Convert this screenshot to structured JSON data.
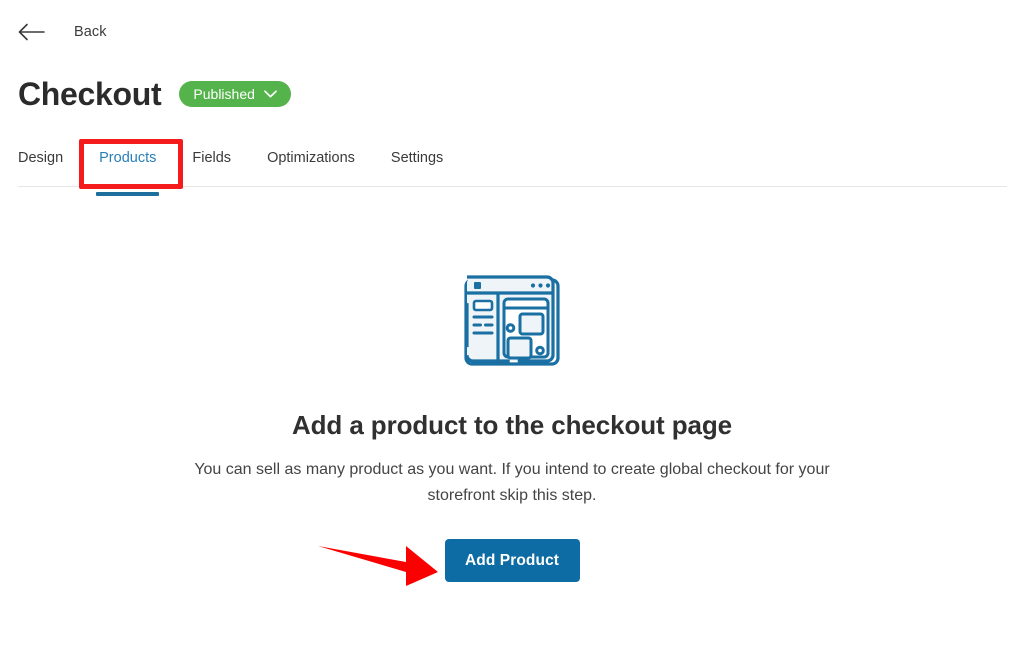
{
  "colors": {
    "accent_blue": "#0e6ca4",
    "tab_active_blue": "#2a7fb8",
    "tab_underline_blue": "#1d6f9e",
    "badge_green": "#54b44b",
    "annotation_red": "#f31b1b",
    "illustration_blue": "#1a6fa3",
    "text_dark": "#2b2b2b",
    "text_body": "#444444",
    "divider": "#e6e6e6"
  },
  "header": {
    "back_label": "Back",
    "back_icon": "arrow-left-icon",
    "title": "Checkout",
    "status": {
      "label": "Published",
      "icon": "chevron-down-icon"
    }
  },
  "tabs": [
    {
      "label": "Design",
      "active": false
    },
    {
      "label": "Products",
      "active": true
    },
    {
      "label": "Fields",
      "active": false
    },
    {
      "label": "Optimizations",
      "active": false
    },
    {
      "label": "Settings",
      "active": false
    }
  ],
  "empty_state": {
    "illustration_icon": "web-page-layout-icon",
    "heading": "Add a product to the checkout page",
    "body": "You can sell as many product as you want. If you intend to create global checkout for your storefront skip this step.",
    "button_label": "Add Product"
  },
  "annotations": {
    "box_target": "Products",
    "arrow_target": "Add Product"
  }
}
